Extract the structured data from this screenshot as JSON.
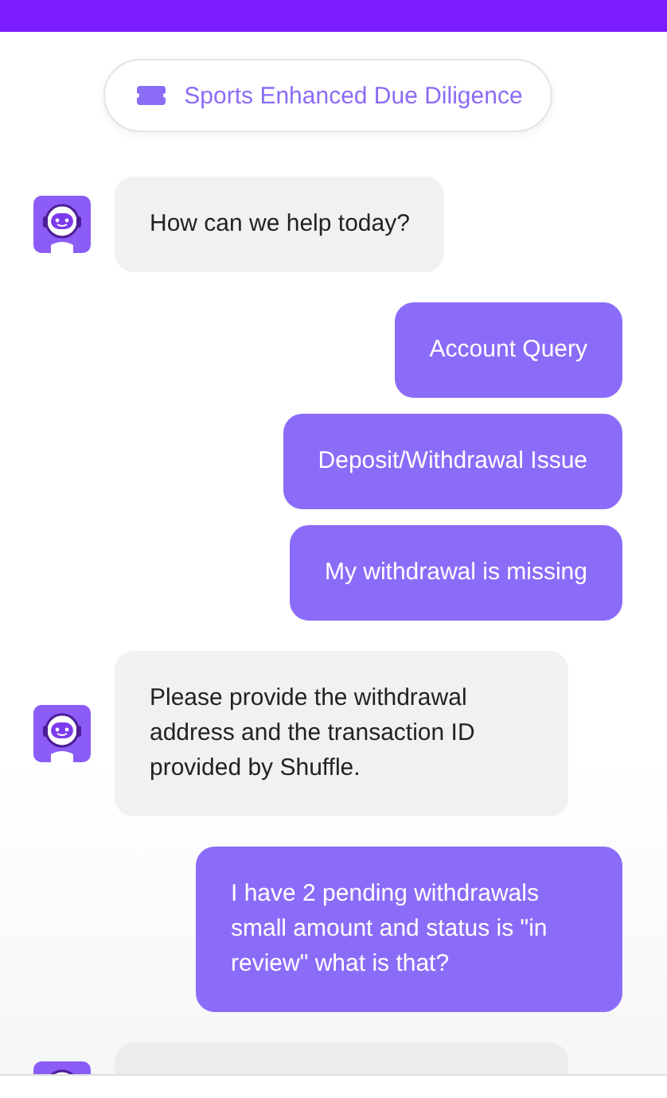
{
  "topic_chip": {
    "label": "Sports Enhanced Due Diligence"
  },
  "messages": [
    {
      "kind": "bot",
      "text": "How can we help today?"
    },
    {
      "kind": "user",
      "text": "Account Query"
    },
    {
      "kind": "user",
      "text": "Deposit/Withdrawal Issue"
    },
    {
      "kind": "user",
      "text": "My withdrawal is missing"
    },
    {
      "kind": "bot",
      "text": "Please provide the withdrawal address and the transaction ID provided by Shuffle."
    },
    {
      "kind": "user",
      "text": "I have 2 pending withdrawals small amount and status is \"in review\" what is that?"
    },
    {
      "kind": "bot"
    }
  ]
}
